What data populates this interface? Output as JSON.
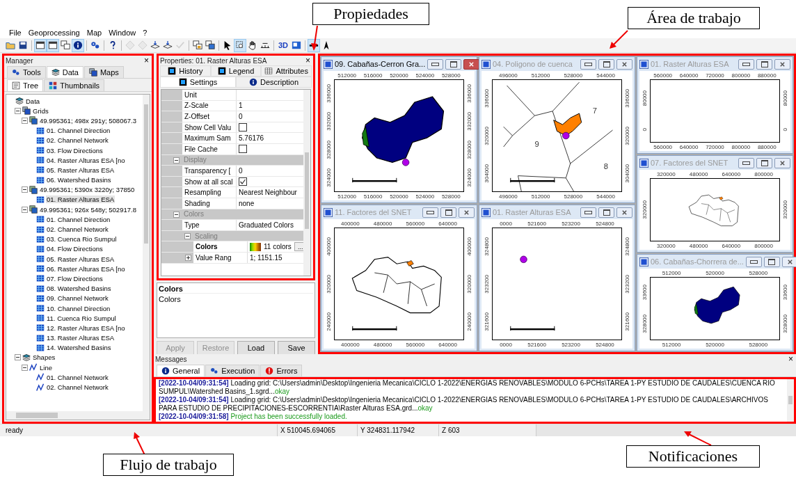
{
  "menu": [
    "File",
    "Geoprocessing",
    "Map",
    "Window",
    "?"
  ],
  "toolbar": [
    {
      "kind": "folder",
      "pressed": false,
      "disabled": false
    },
    {
      "kind": "save",
      "pressed": false,
      "disabled": false
    },
    {
      "kind": "separator"
    },
    {
      "kind": "window",
      "pressed": true,
      "disabled": false
    },
    {
      "kind": "window",
      "pressed": true,
      "disabled": false
    },
    {
      "kind": "windows",
      "pressed": false,
      "disabled": false
    },
    {
      "kind": "info",
      "pressed": true,
      "disabled": false
    },
    {
      "kind": "separator"
    },
    {
      "kind": "gears",
      "pressed": false,
      "disabled": false
    },
    {
      "kind": "separator"
    },
    {
      "kind": "help",
      "pressed": false,
      "disabled": false
    },
    {
      "kind": "separator"
    },
    {
      "kind": "diamond",
      "pressed": false,
      "disabled": true
    },
    {
      "kind": "diamond",
      "pressed": false,
      "disabled": true
    },
    {
      "kind": "layers",
      "pressed": false,
      "disabled": false
    },
    {
      "kind": "layers",
      "pressed": false,
      "disabled": false
    },
    {
      "kind": "check",
      "pressed": false,
      "disabled": true
    },
    {
      "kind": "separator"
    },
    {
      "kind": "lock",
      "pressed": false,
      "disabled": false
    },
    {
      "kind": "tile",
      "pressed": false,
      "disabled": false
    },
    {
      "kind": "separator"
    },
    {
      "kind": "cursor",
      "pressed": false,
      "disabled": false
    },
    {
      "kind": "zoom",
      "pressed": true,
      "disabled": false
    },
    {
      "kind": "hand",
      "pressed": false,
      "disabled": false
    },
    {
      "kind": "measure",
      "pressed": false,
      "disabled": false
    },
    {
      "kind": "separator"
    },
    {
      "kind": "text",
      "label": "3D",
      "pressed": false,
      "disabled": false
    },
    {
      "kind": "map",
      "pressed": false,
      "disabled": false
    },
    {
      "kind": "separator"
    },
    {
      "kind": "line",
      "pressed": true,
      "disabled": false
    },
    {
      "kind": "north",
      "pressed": false,
      "disabled": false
    }
  ],
  "manager": {
    "title": "Manager",
    "close": "×",
    "tabs": [
      {
        "label": "Tools",
        "kind": "gears",
        "selected": false
      },
      {
        "label": "Data",
        "kind": "layers",
        "selected": true
      },
      {
        "label": "Maps",
        "kind": "windows",
        "selected": false
      }
    ],
    "subtabs": [
      {
        "label": "Tree",
        "kind": "tree",
        "selected": true
      },
      {
        "label": "Thumbnails",
        "kind": "thumbs",
        "selected": false
      }
    ],
    "tree": [
      {
        "label": "Data",
        "kind": "data",
        "selected": false,
        "children": [
          {
            "label": "Grids",
            "kind": "grids",
            "selected": false,
            "expanded": true,
            "children": [
              {
                "label": "49.995361; 498x 291y; 508067.3",
                "kind": "system",
                "selected": false,
                "expanded": true,
                "children": [
                  {
                    "label": "01. Channel Direction",
                    "kind": "grid",
                    "selected": false
                  },
                  {
                    "label": "02. Channel Network",
                    "kind": "grid",
                    "selected": false
                  },
                  {
                    "label": "03. Flow Directions",
                    "kind": "grid",
                    "selected": false
                  },
                  {
                    "label": "04. Raster Alturas ESA [no",
                    "kind": "grid",
                    "selected": false
                  },
                  {
                    "label": "05. Raster Alturas ESA",
                    "kind": "grid",
                    "selected": false
                  },
                  {
                    "label": "06. Watershed Basins",
                    "kind": "grid",
                    "selected": false
                  }
                ]
              },
              {
                "label": "49.995361; 5390x 3220y; 37850",
                "kind": "system",
                "selected": false,
                "expanded": true,
                "children": [
                  {
                    "label": "01. Raster Alturas ESA",
                    "kind": "grid",
                    "selected": true
                  }
                ]
              },
              {
                "label": "49.995361; 926x 548y; 502917.8",
                "kind": "system",
                "selected": false,
                "expanded": true,
                "children": [
                  {
                    "label": "01. Channel Direction",
                    "kind": "grid",
                    "selected": false
                  },
                  {
                    "label": "02. Channel Network",
                    "kind": "grid",
                    "selected": false
                  },
                  {
                    "label": "03. Cuenca Rio Sumpul",
                    "kind": "grid",
                    "selected": false
                  },
                  {
                    "label": "04. Flow Directions",
                    "kind": "grid",
                    "selected": false
                  },
                  {
                    "label": "05. Raster Alturas ESA",
                    "kind": "grid",
                    "selected": false
                  },
                  {
                    "label": "06. Raster Alturas ESA [no",
                    "kind": "grid",
                    "selected": false
                  },
                  {
                    "label": "07. Flow Directions",
                    "kind": "grid",
                    "selected": false
                  },
                  {
                    "label": "08. Watershed Basins",
                    "kind": "grid",
                    "selected": false
                  },
                  {
                    "label": "09. Channel Network",
                    "kind": "grid",
                    "selected": false
                  },
                  {
                    "label": "10. Channel Direction",
                    "kind": "grid",
                    "selected": false
                  },
                  {
                    "label": "11. Cuenca Rio Sumpul",
                    "kind": "grid",
                    "selected": false
                  },
                  {
                    "label": "12. Raster Alturas ESA [no",
                    "kind": "grid",
                    "selected": false
                  },
                  {
                    "label": "13. Raster Alturas ESA",
                    "kind": "grid",
                    "selected": false
                  },
                  {
                    "label": "14. Watershed Basins",
                    "kind": "grid",
                    "selected": false
                  }
                ]
              }
            ]
          },
          {
            "label": "Shapes",
            "kind": "shapes",
            "selected": false,
            "expanded": true,
            "children": [
              {
                "label": "Line",
                "kind": "line",
                "selected": false,
                "expanded": true,
                "children": [
                  {
                    "label": "01. Channel Network",
                    "kind": "line",
                    "selected": false
                  },
                  {
                    "label": "02. Channel Network",
                    "kind": "line",
                    "selected": false
                  }
                ]
              }
            ]
          }
        ]
      }
    ]
  },
  "properties": {
    "title": "Properties: 01. Raster Alturas ESA",
    "close": "×",
    "tab_rows": [
      {
        "tabs": [
          {
            "label": "History",
            "kind": "square",
            "selected": false
          },
          {
            "label": "Legend",
            "kind": "square",
            "selected": false
          },
          {
            "label": "Attributes",
            "kind": "table",
            "selected": false
          }
        ]
      },
      {
        "tabs": [
          {
            "label": "Settings",
            "kind": "square",
            "selected": true
          },
          {
            "label": "Description",
            "kind": "info",
            "selected": false
          }
        ]
      }
    ],
    "rows": [
      {
        "kind": "value",
        "name": "Unit"
      },
      {
        "kind": "value",
        "name": "Z-Scale",
        "value": "1"
      },
      {
        "kind": "value",
        "name": "Z-Offset",
        "value": "0"
      },
      {
        "kind": "checkbox",
        "name": "Show Cell Valu",
        "checked": false
      },
      {
        "kind": "value",
        "name": "Maximum Sam",
        "value": "5.76176"
      },
      {
        "kind": "checkbox",
        "name": "File Cache",
        "checked": false
      },
      {
        "kind": "group",
        "name": "Display",
        "expanded": true,
        "children": [
          {
            "kind": "value",
            "name": "Transparency [",
            "value": "0"
          },
          {
            "kind": "checkbox",
            "name": "Show at all scal",
            "checked": true
          },
          {
            "kind": "value",
            "name": "Resampling",
            "value": "Nearest Neighbour"
          },
          {
            "kind": "value",
            "name": "Shading",
            "value": "none"
          }
        ]
      },
      {
        "kind": "group",
        "name": "Colors",
        "expanded": true,
        "children": [
          {
            "kind": "value",
            "name": "Type",
            "value": "Graduated Colors"
          },
          {
            "kind": "group",
            "name": "Scaling",
            "expanded": true,
            "children": [
              {
                "kind": "colors",
                "name": "Colors",
                "value": "11 colors",
                "button": "..."
              },
              {
                "kind": "range",
                "name": "Value Rang",
                "value": "1; 1151.15",
                "expanded": false
              }
            ]
          }
        ]
      }
    ],
    "description": {
      "title": "Colors",
      "text": "Colors"
    },
    "buttons": [
      {
        "label": "Apply",
        "disabled": true
      },
      {
        "label": "Restore",
        "disabled": true
      },
      {
        "label": "Load",
        "disabled": false
      },
      {
        "label": "Save",
        "disabled": false
      }
    ]
  },
  "workspace": {
    "columns": [
      {
        "windows": [
          {
            "title": "09. Cabañas-Cerron Gra...",
            "selected": true,
            "kind": "basin",
            "outlet_point": true,
            "scale_bar": true,
            "top_ticks": [
              "512000",
              "516000",
              "520000",
              "524000",
              "528000"
            ],
            "left_ticks": [
              "336000",
              "332000",
              "328000",
              "324000"
            ],
            "right_ticks": [
              "336000",
              "332000",
              "328000",
              "324000"
            ],
            "bottom_ticks": [
              "512000",
              "516000",
              "520000",
              "524000",
              "528000"
            ]
          },
          {
            "title": "11. Factores del SNET",
            "selected": false,
            "kind": "country",
            "outlet_point": false,
            "scale_bar": true,
            "top_ticks": [
              "400000",
              "480000",
              "560000",
              "640000"
            ],
            "left_ticks": [
              "400000",
              "320000",
              "240000"
            ],
            "right_ticks": [
              "400000",
              "320000",
              "240000"
            ],
            "bottom_ticks": [
              "400000",
              "480000",
              "560000",
              "640000"
            ]
          }
        ]
      },
      {
        "windows": [
          {
            "title": "04. Poligono de cuenca",
            "selected": false,
            "kind": "polygons",
            "labels": [
              "7",
              "9",
              "8"
            ],
            "outlet_point": true,
            "scale_bar": true,
            "top_ticks": [
              "496000",
              "512000",
              "528000",
              "544000"
            ],
            "left_ticks": [
              "336000",
              "320000",
              "304000"
            ],
            "right_ticks": [
              "336000",
              "320000",
              "304000"
            ],
            "bottom_ticks": [
              "496000",
              "512000",
              "528000",
              "544000"
            ]
          },
          {
            "title": "01. Raster Alturas ESA",
            "selected": false,
            "kind": "empty",
            "outlet_point": true,
            "scale_bar": true,
            "top_ticks": [
              "0000",
              "521600",
              "523200",
              "524800"
            ],
            "left_ticks": [
              "324800",
              "323200",
              "321600"
            ],
            "right_ticks": [
              "324800",
              "323200",
              "321600"
            ],
            "bottom_ticks": [
              "0000",
              "521600",
              "523200",
              "524800"
            ]
          }
        ]
      },
      {
        "windows": [
          {
            "title": "01. Raster Alturas ESA",
            "selected": false,
            "kind": "empty",
            "outlet_point": false,
            "scale_bar": false,
            "top_ticks": [
              "560000",
              "640000",
              "720000",
              "800000",
              "880000"
            ],
            "left_ticks": [
              "80000",
              "0"
            ],
            "right_ticks": [
              "80000",
              "0"
            ],
            "bottom_ticks": [
              "560000",
              "640000",
              "720000",
              "800000",
              "880000"
            ]
          },
          {
            "title": "07. Factores del SNET",
            "selected": false,
            "kind": "country",
            "outlet_point": false,
            "scale_bar": false,
            "top_ticks": [
              "320000",
              "480000",
              "640000",
              "800000"
            ],
            "left_ticks": [
              "320000"
            ],
            "right_ticks": [
              "320000"
            ],
            "bottom_ticks": [
              "320000",
              "480000",
              "640000",
              "800000"
            ]
          },
          {
            "title": "06. Cabañas-Chorrera de...",
            "selected": false,
            "kind": "basin",
            "outlet_point": false,
            "scale_bar": false,
            "top_ticks": [
              "512000",
              "520000",
              "528000"
            ],
            "left_ticks": [
              "33600",
              "328000"
            ],
            "right_ticks": [
              "33600",
              "328000"
            ],
            "bottom_ticks": [
              "512000",
              "520000",
              "528000"
            ]
          }
        ]
      }
    ]
  },
  "messages": {
    "title": "Messages",
    "close": "×",
    "tabs": [
      {
        "label": "General",
        "kind": "info",
        "selected": true
      },
      {
        "label": "Execution",
        "kind": "gears",
        "selected": false
      },
      {
        "label": "Errors",
        "kind": "error",
        "selected": false
      }
    ],
    "log": [
      {
        "timestamp": "[2022-10-04/09:31:54]",
        "parts": [
          {
            "kind": "plain",
            "text": "Loading grid: C:\\Users\\admin\\Desktop\\Ingenieria Mecanica\\CICLO 1-2022\\ENERGIAS RENOVABLES\\MODULO 6-PCHs\\TAREA 1-PY ESTUDIO DE CAUDALES\\CUENCA RIO SUMPUL\\Watershed Basins_1.sgrd..."
          },
          {
            "kind": "success",
            "text": "okay"
          }
        ]
      },
      {
        "timestamp": "[2022-10-04/09:31:54]",
        "parts": [
          {
            "kind": "plain",
            "text": "Loading grid: C:\\Users\\admin\\Desktop\\Ingenieria Mecanica\\CICLO 1-2022\\ENERGIAS RENOVABLES\\MODULO 6-PCHs\\TAREA 1-PY ESTUDIO DE CAUDALES\\ARCHIVOS PARA ESTUDIO DE PRECIPITACIONES-ESCORRENTIA\\Raster Alturas ESA.grd..."
          },
          {
            "kind": "success",
            "text": "okay"
          }
        ]
      },
      {
        "timestamp": "[2022-10-04/09:31:58]",
        "parts": [
          {
            "kind": "success",
            "text": "Project has been successfully loaded."
          }
        ]
      }
    ]
  },
  "status_bar": [
    "ready",
    "X 510045.694065",
    "Y 324831.117942",
    "Z 603"
  ],
  "annotations": [
    "Propiedades",
    "Área de trabajo",
    "Flujo de trabajo",
    "Notificaciones"
  ]
}
